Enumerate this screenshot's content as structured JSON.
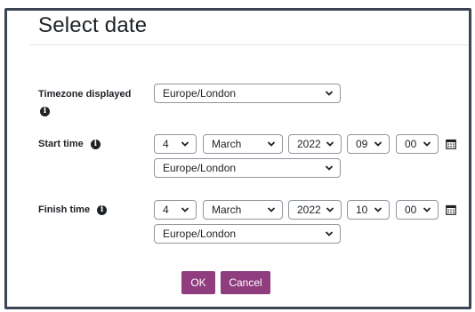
{
  "dialog": {
    "title": "Select date"
  },
  "timezone": {
    "label": "Timezone displayed",
    "value": "Europe/London"
  },
  "start": {
    "label": "Start time",
    "day": "4",
    "month": "March",
    "year": "2022",
    "hour": "09",
    "minute": "00",
    "timezone": "Europe/London"
  },
  "finish": {
    "label": "Finish time",
    "day": "4",
    "month": "March",
    "year": "2022",
    "hour": "10",
    "minute": "00",
    "timezone": "Europe/London"
  },
  "buttons": {
    "ok": "OK",
    "cancel": "Cancel"
  },
  "icons": {
    "info": "info-icon",
    "chevron": "chevron-down-icon",
    "calendar": "calendar-icon"
  },
  "colors": {
    "primary_button": "#8f3d7f",
    "frame_border": "#3b4452"
  }
}
